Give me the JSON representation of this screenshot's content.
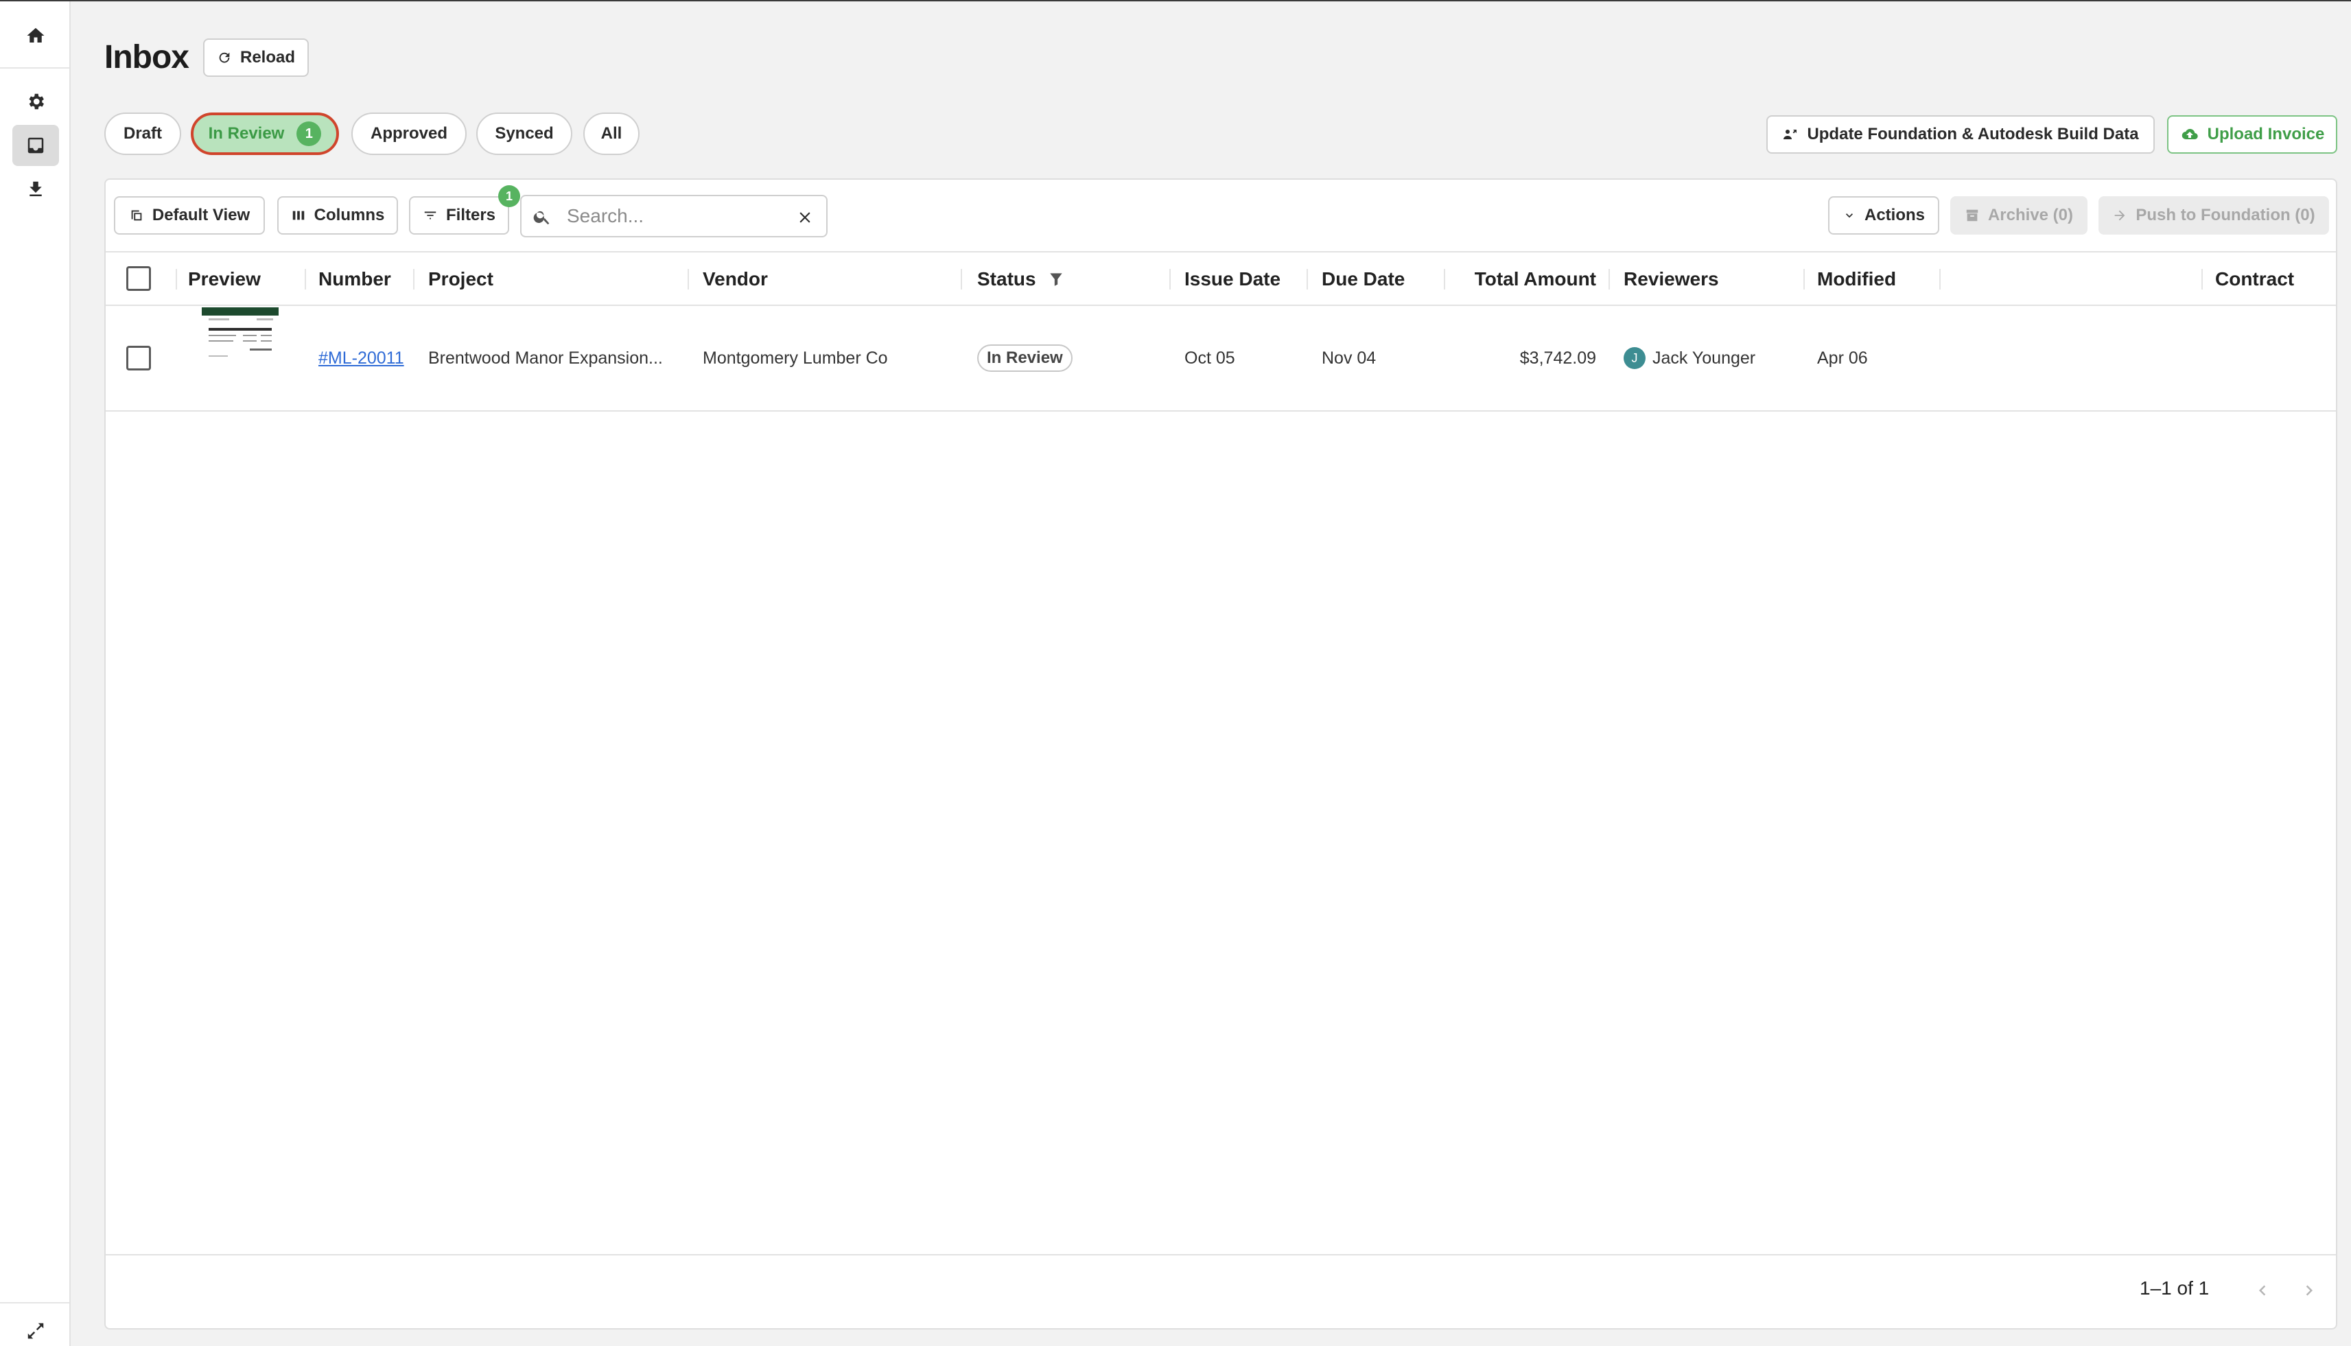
{
  "sidebar": {
    "items": [
      {
        "icon": "home-icon"
      },
      {
        "icon": "gear-icon"
      },
      {
        "icon": "inbox-icon",
        "active": true
      },
      {
        "icon": "download-icon"
      },
      {
        "icon": "expand-icon"
      }
    ]
  },
  "header": {
    "title": "Inbox",
    "reload_label": "Reload"
  },
  "tabs": [
    {
      "label": "Draft"
    },
    {
      "label": "In Review",
      "count": "1",
      "active": true
    },
    {
      "label": "Approved"
    },
    {
      "label": "Synced"
    },
    {
      "label": "All"
    }
  ],
  "top_actions": {
    "update_label": "Update Foundation & Autodesk Build Data",
    "upload_label": "Upload Invoice"
  },
  "toolbar": {
    "default_view_label": "Default View",
    "columns_label": "Columns",
    "filters_label": "Filters",
    "filters_count": "1",
    "search_placeholder": "Search...",
    "actions_label": "Actions",
    "archive_label": "Archive (0)",
    "push_label": "Push to Foundation (0)"
  },
  "table": {
    "columns": [
      "Preview",
      "Number",
      "Project",
      "Vendor",
      "Status",
      "Issue Date",
      "Due Date",
      "Total Amount",
      "Reviewers",
      "Modified",
      "Contract"
    ],
    "rows": [
      {
        "number": "#ML-20011",
        "project": "Brentwood Manor Expansion...",
        "vendor": "Montgomery Lumber Co",
        "status": "In Review",
        "issue_date": "Oct 05",
        "due_date": "Nov 04",
        "total_amount": "$3,742.09",
        "reviewer_initial": "J",
        "reviewer": "Jack Younger",
        "modified": "Apr 06",
        "contract": ""
      }
    ]
  },
  "pagination": {
    "range": "1–1 of 1"
  },
  "colors": {
    "accent_green": "#57b360",
    "active_tab_bg": "#b9e3bd",
    "active_tab_border": "#d0452c",
    "link_blue": "#2f6bd6"
  }
}
